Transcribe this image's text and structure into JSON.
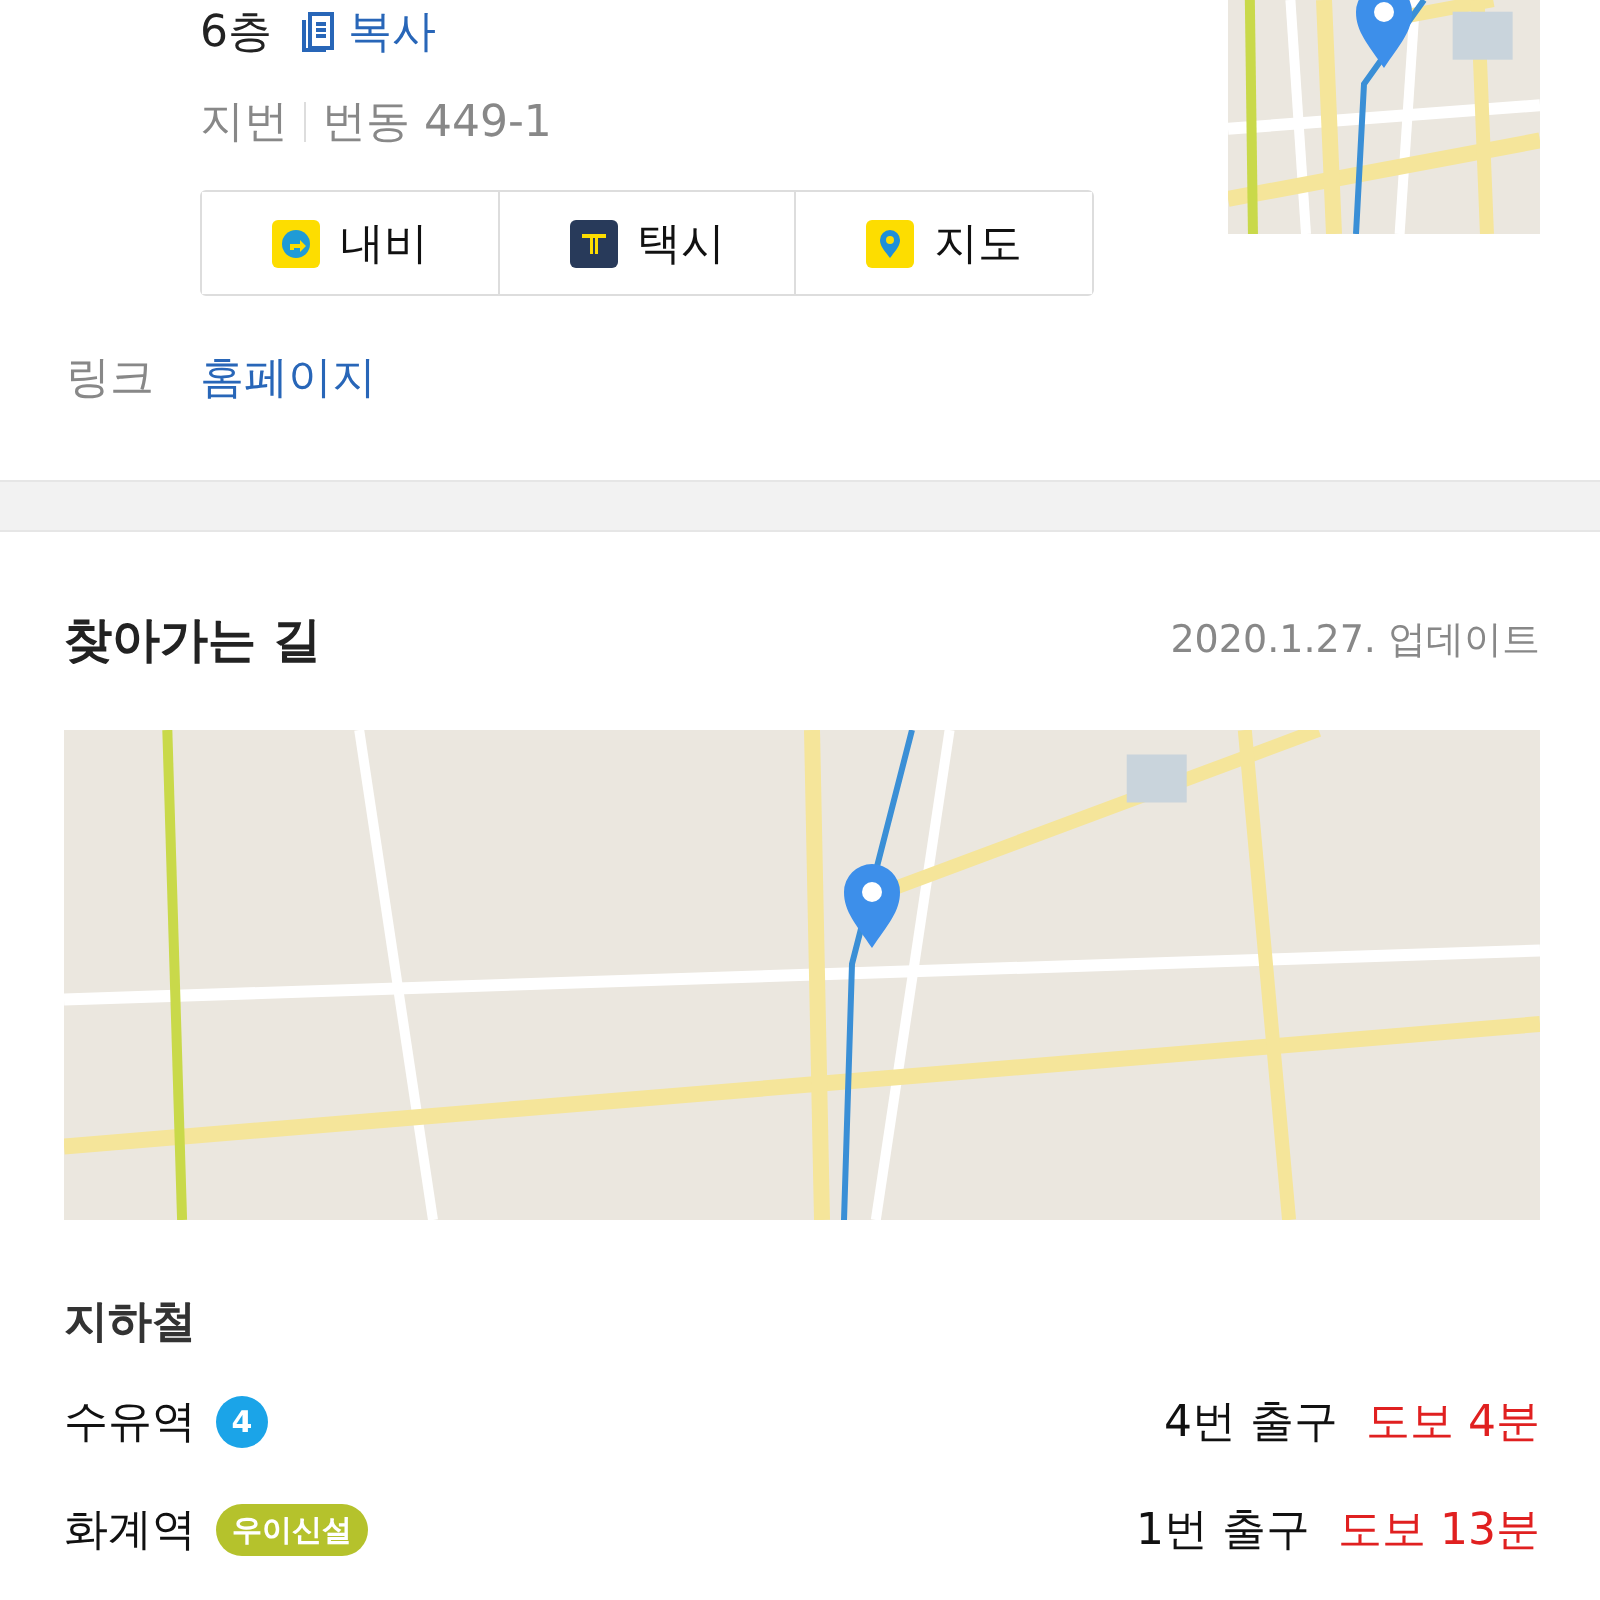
{
  "place": {
    "floor": "6층",
    "copy_button": "복사",
    "lot_label": "지번",
    "lot_address": "번동 449-1",
    "actions": [
      {
        "kind": "navi",
        "label": "내비"
      },
      {
        "kind": "taxi",
        "label": "택시"
      },
      {
        "kind": "map",
        "label": "지도"
      }
    ],
    "link_label": "링크",
    "link": "홈페이지"
  },
  "directions": {
    "title": "찾아가는 길",
    "updated": "2020.1.27. 업데이트",
    "subway_heading": "지하철",
    "stations": [
      {
        "name": "수유역",
        "line": "4",
        "color": "#1ba4e8",
        "exit": "4번 출구",
        "walk": "도보 4분"
      },
      {
        "name": "화계역",
        "line": "우이신설",
        "color": "#b5c22c",
        "exit": "1번 출구",
        "walk": "도보 13분"
      }
    ]
  }
}
